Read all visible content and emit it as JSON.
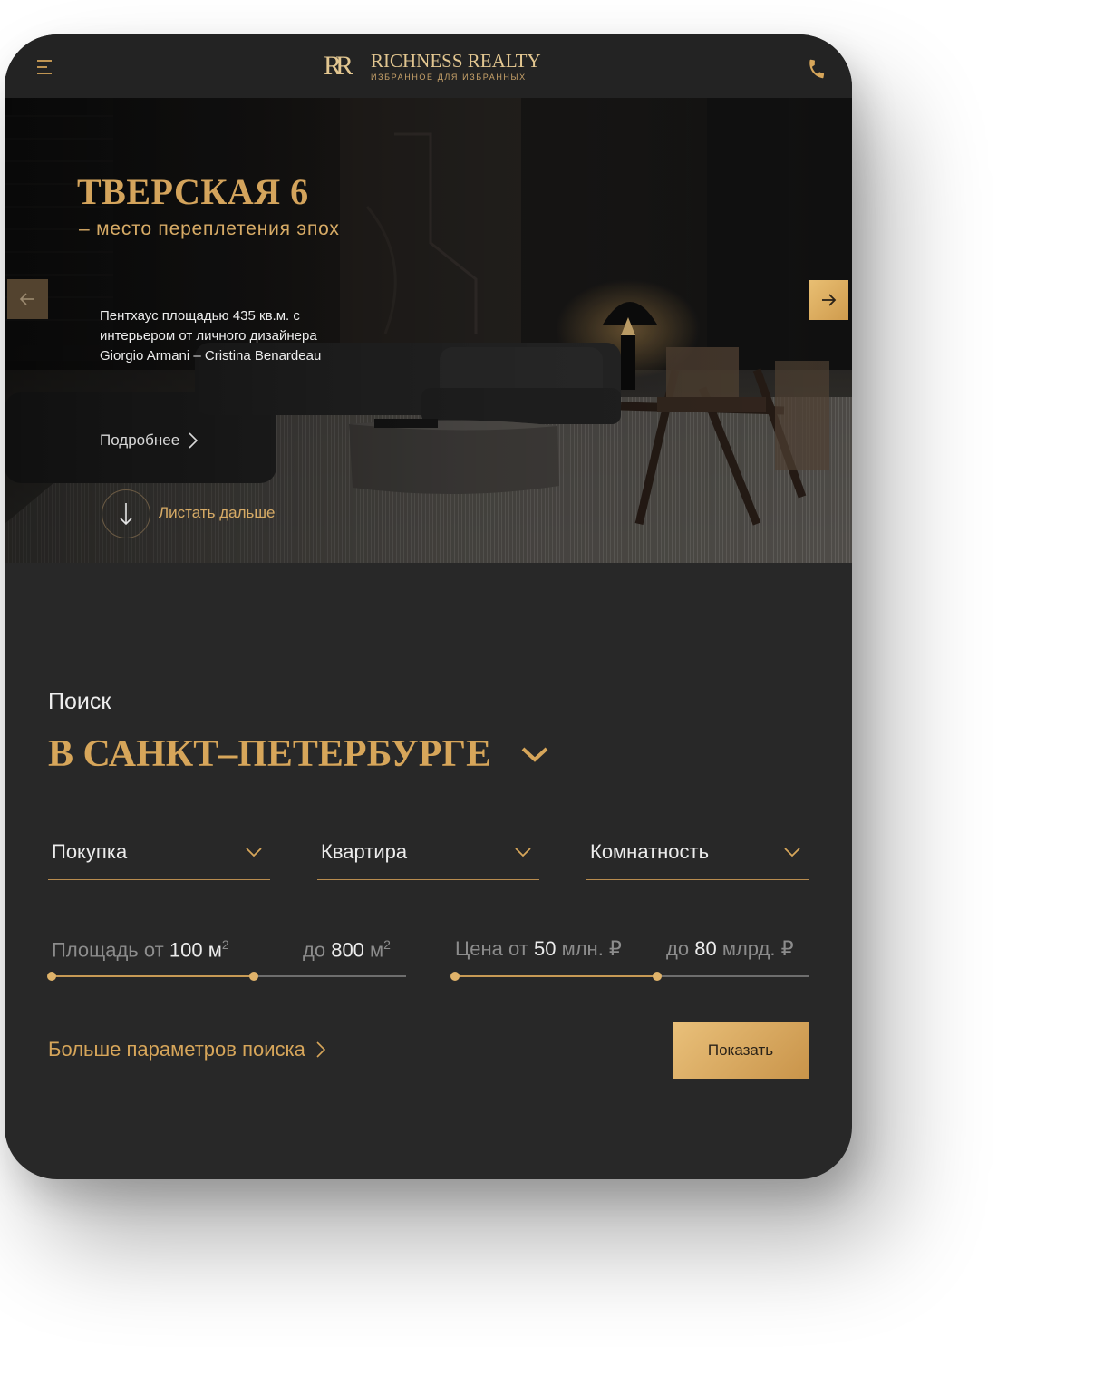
{
  "header": {
    "logo_mark": "RR",
    "brand_name": "RICHNESS REALTY",
    "brand_tagline": "ИЗБРАННОЕ ДЛЯ ИЗБРАННЫХ",
    "menu_icon": "hamburger-icon",
    "phone_icon": "phone-icon"
  },
  "hero": {
    "title": "ТВЕРСКАЯ 6",
    "subtitle": "– место переплетения эпох",
    "description": "Пентхаус площадью 435 кв.м. с интерьером от личного дизайнера Giorgio Armani – Cristina Benardeau",
    "more_label": "Подробнее",
    "scroll_label": "Листать дальше",
    "prev_icon": "arrow-left-icon",
    "next_icon": "arrow-right-icon"
  },
  "search": {
    "label": "Поиск",
    "city": "В САНКТ–ПЕТЕРБУРГЕ",
    "deal_type": "Покупка",
    "property_type": "Квартира",
    "rooms": "Комнатность",
    "area": {
      "from_label": "Площадь от",
      "from_value": "100",
      "from_unit": "м",
      "to_label": "до",
      "to_value": "800",
      "to_unit": "м",
      "exponent": "2",
      "slider_from_fraction": 0.0,
      "slider_to_fraction": 0.57
    },
    "price": {
      "from_label": "Цена от",
      "from_value": "50",
      "from_unit": "млн. ₽",
      "to_label": "до",
      "to_value": "80",
      "to_unit": "млрд. ₽",
      "slider_from_fraction": 0.0,
      "slider_to_fraction": 0.57
    },
    "more_params_label": "Больше параметров поиска",
    "show_button": "Показать"
  },
  "colors": {
    "accent_gold": "#d7a65a",
    "background": "#282828",
    "header_bg": "#232323"
  }
}
